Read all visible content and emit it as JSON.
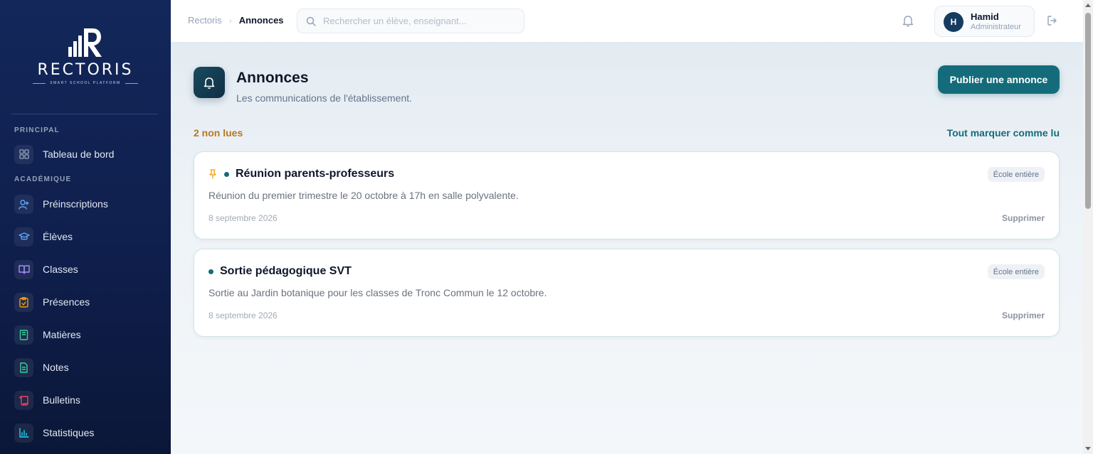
{
  "brand": {
    "name": "RECTORIS",
    "tagline": "SMART SCHOOL PLATFORM"
  },
  "sidebar": {
    "sections": [
      {
        "label": "PRINCIPAL"
      },
      {
        "label": "ACADÉMIQUE"
      }
    ],
    "items": [
      {
        "label": "Tableau de bord",
        "icon": "dashboard-grid-icon",
        "color": "#94a3b8"
      },
      {
        "label": "Préinscriptions",
        "icon": "user-plus-icon",
        "color": "#60a5fa"
      },
      {
        "label": "Élèves",
        "icon": "graduation-cap-icon",
        "color": "#60a5fa"
      },
      {
        "label": "Classes",
        "icon": "book-open-icon",
        "color": "#a78bfa"
      },
      {
        "label": "Présences",
        "icon": "clipboard-check-icon",
        "color": "#f59e0b"
      },
      {
        "label": "Matières",
        "icon": "book-icon",
        "color": "#34d399"
      },
      {
        "label": "Notes",
        "icon": "file-text-icon",
        "color": "#34d399"
      },
      {
        "label": "Bulletins",
        "icon": "scroll-icon",
        "color": "#f43f5e"
      },
      {
        "label": "Statistiques",
        "icon": "bar-chart-icon",
        "color": "#22d3ee"
      }
    ]
  },
  "topbar": {
    "breadcrumb_root": "Rectoris",
    "breadcrumb_current": "Annonces",
    "search_placeholder": "Rechercher un élève, enseignant...",
    "user": {
      "initial": "H",
      "name": "Hamid",
      "role": "Administrateur"
    }
  },
  "page": {
    "title": "Annonces",
    "subtitle": "Les communications de l'établissement.",
    "publish_label": "Publier une annonce",
    "unread_label": "2 non lues",
    "mark_all_label": "Tout marquer comme lu"
  },
  "announcements": [
    {
      "pinned": true,
      "unread": true,
      "title": "Réunion parents-professeurs",
      "audience": "École entière",
      "body": "Réunion du premier trimestre le 20 octobre à 17h en salle polyvalente.",
      "date": "8 septembre 2026",
      "delete_label": "Supprimer"
    },
    {
      "pinned": false,
      "unread": true,
      "title": "Sortie pédagogique SVT",
      "audience": "École entière",
      "body": "Sortie au Jardin botanique pour les classes de Tronc Commun le 12 octobre.",
      "date": "8 septembre 2026",
      "delete_label": "Supprimer"
    }
  ],
  "colors": {
    "accent": "#146c7a",
    "sidebar_bg": "#13275a",
    "unread": "#b7791f",
    "pin": "#f59e0b"
  }
}
